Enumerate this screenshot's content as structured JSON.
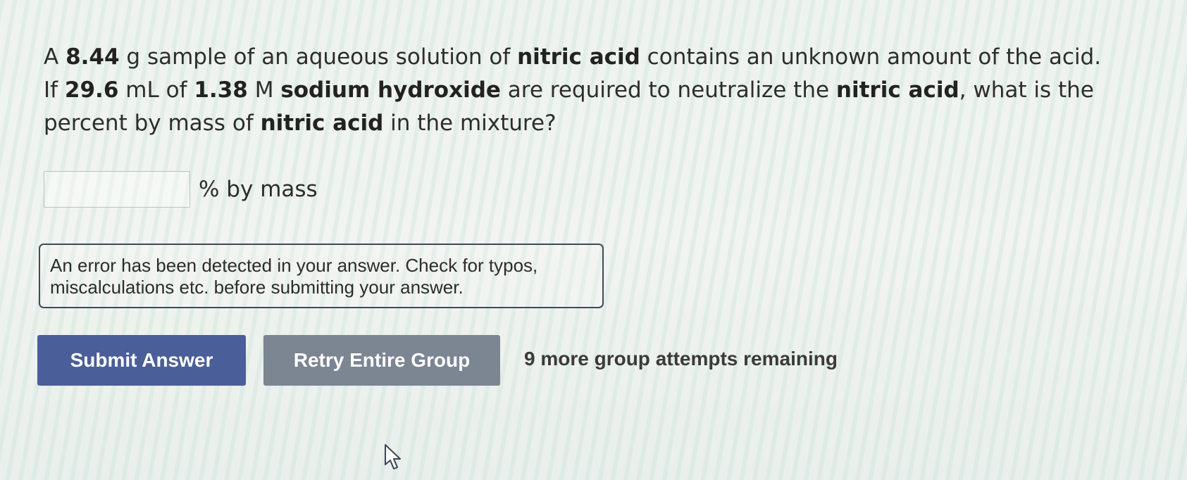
{
  "question": {
    "line1": {
      "t1": "A ",
      "b1": "8.44",
      "t2": " g sample of an aqueous solution of ",
      "b2": "nitric acid",
      "t3": " contains an unknown amount of the acid."
    },
    "line2": {
      "t1": "If ",
      "b1": "29.6",
      "t2": " mL of ",
      "b2": "1.38",
      "t3": " M ",
      "b3": "sodium hydroxide",
      "t4": " are required to neutralize the ",
      "b4": "nitric acid",
      "t5": ", what is the"
    },
    "line3": {
      "t1": "percent by mass of ",
      "b1": "nitric acid",
      "t2": " in the mixture?"
    }
  },
  "answer": {
    "value": "",
    "unit": "% by mass"
  },
  "error": {
    "line1": "An error has been detected in your answer. Check for typos,",
    "line2": "miscalculations etc. before submitting your answer."
  },
  "buttons": {
    "submit": "Submit Answer",
    "retry": "Retry Entire Group"
  },
  "attempts": "9 more group attempts remaining",
  "colors": {
    "submit_bg": "#4a5f99",
    "retry_bg": "#7c8592",
    "error_border": "#3e4a57"
  },
  "icons": {
    "cursor": "mouse-pointer-icon"
  }
}
